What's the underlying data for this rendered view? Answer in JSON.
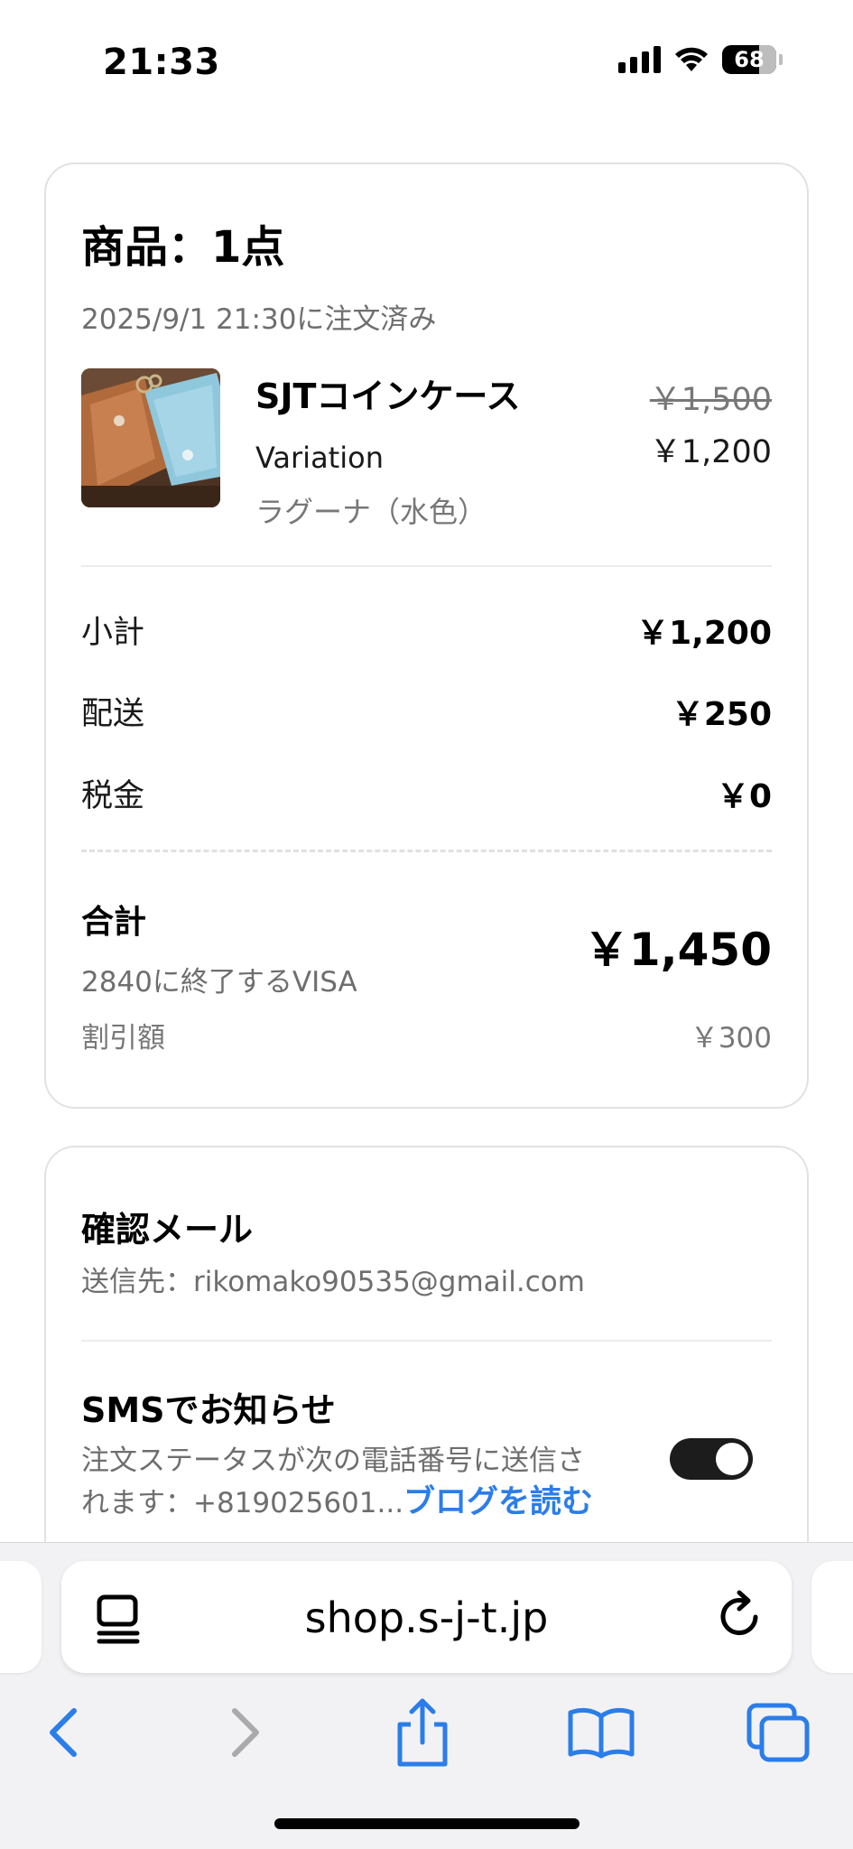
{
  "status_bar": {
    "time": "21:33",
    "battery": "68",
    "icons": [
      "signal-icon",
      "wifi-icon",
      "battery-icon"
    ]
  },
  "order": {
    "title": "商品：1点",
    "date": "2025/9/1 21:30に注文済み",
    "product": {
      "name": "SJTコインケース",
      "variation_label": "Variation",
      "variation_value": "ラグーナ（水色）",
      "price_original": "￥1,500",
      "price_current": "￥1,200"
    },
    "rows": [
      {
        "label": "小計",
        "value": "￥1,200"
      },
      {
        "label": "配送",
        "value": "￥250"
      },
      {
        "label": "税金",
        "value": "￥0"
      }
    ],
    "total": {
      "label": "合計",
      "value": "￥1,450",
      "payment_method": "2840に終了するVISA",
      "discount_label": "割引額",
      "discount_value": "￥300"
    }
  },
  "notifications": {
    "email_title": "確認メール",
    "email_text": "送信先：rikomako90535@gmail.com",
    "sms_title": "SMSでお知らせ",
    "sms_text_line1": "注文ステータスが次の電話番号に送信さ",
    "sms_text_line2": "れます：+819025601...",
    "sms_link": "ブログを読む",
    "sms_enabled": true
  },
  "browser": {
    "url": "shop.s-j-t.jp",
    "toolbar": [
      "back-icon",
      "forward-icon",
      "share-icon",
      "bookmarks-icon",
      "tabs-icon"
    ]
  },
  "colors": {
    "accent": "#2b7de9",
    "muted_text": "#6e6e6e",
    "card_border": "#e2e2e2",
    "toolbar_bg": "#f2f2f4"
  }
}
